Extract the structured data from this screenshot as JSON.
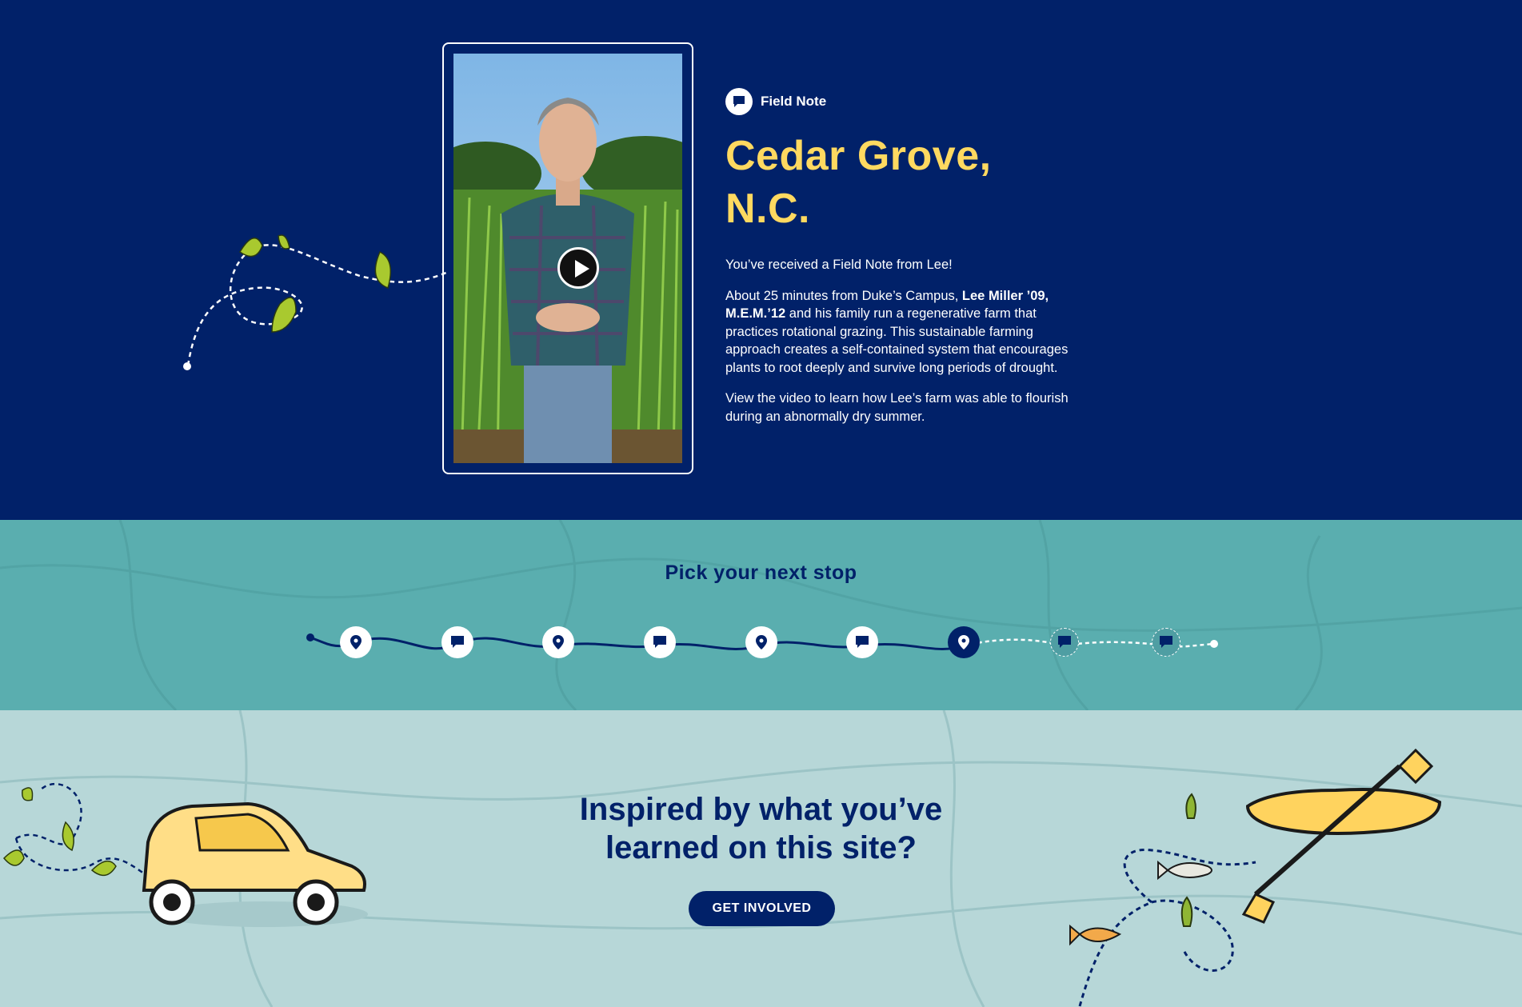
{
  "field_note": {
    "label": "Field Note",
    "title_line1": "Cedar Grove,",
    "title_line2": "N.C.",
    "intro": "You’ve received a Field Note from Lee!",
    "body_pre": "About 25 minutes from Duke’s Campus, ",
    "body_name": "Lee Miller ’09, M.E.M.’12",
    "body_post": " and his family run a regenerative farm that practices rotational grazing. This sustainable farming approach creates a self-contained system that encourages plants to root deeply and survive long periods of drought.",
    "cta_text": "View the video to learn how Lee’s farm was able to flourish during an abnormally dry summer."
  },
  "stops": {
    "title": "Pick your next stop",
    "items": [
      {
        "type": "location",
        "state": "visited"
      },
      {
        "type": "note",
        "state": "visited"
      },
      {
        "type": "location",
        "state": "visited"
      },
      {
        "type": "note",
        "state": "visited"
      },
      {
        "type": "location",
        "state": "visited"
      },
      {
        "type": "note",
        "state": "visited"
      },
      {
        "type": "location",
        "state": "current"
      },
      {
        "type": "note",
        "state": "upcoming"
      },
      {
        "type": "note",
        "state": "upcoming"
      }
    ]
  },
  "cta": {
    "heading_line1": "Inspired by what you’ve",
    "heading_line2": "learned on this site?",
    "button": "GET INVOLVED"
  },
  "colors": {
    "navy": "#012169",
    "gold": "#ffd960",
    "teal": "#5aaeaf",
    "light_teal": "#b7d7d8",
    "leaf_green": "#9bbf2f"
  }
}
